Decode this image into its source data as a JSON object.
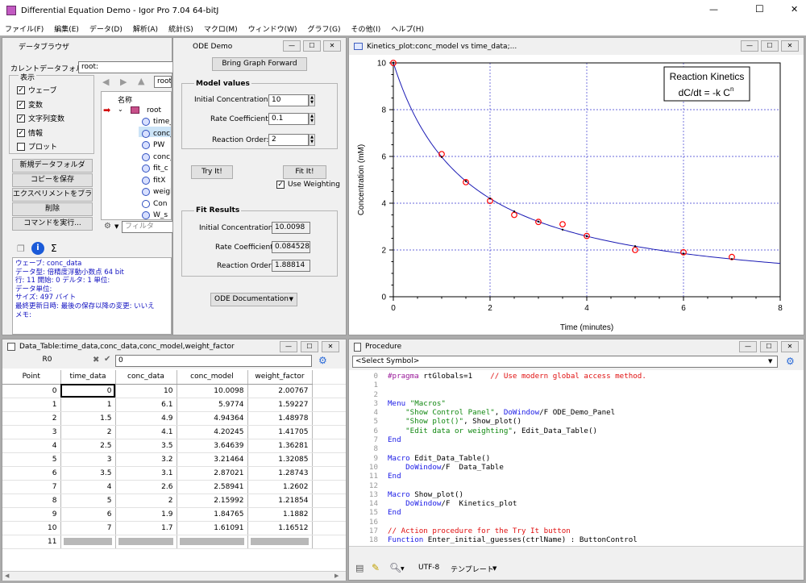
{
  "app": {
    "title": "Differential Equation Demo - Igor Pro 7.04 64-bitJ",
    "minimize": "—",
    "maximize": "☐",
    "close": "✕"
  },
  "menu": [
    "ファイル(F)",
    "編集(E)",
    "データ(D)",
    "解析(A)",
    "統計(S)",
    "マクロ(M)",
    "ウィンドウ(W)",
    "グラフ(G)",
    "その他(I)",
    "ヘルプ(H)"
  ],
  "browser": {
    "title": "データブラウザ",
    "cur_folder_label": "カレントデータフォルダ:",
    "cur_folder_value": "root:",
    "display_label": "表示",
    "checks": [
      {
        "label": "ウェーブ",
        "checked": "✓"
      },
      {
        "label": "変数",
        "checked": "✓"
      },
      {
        "label": "文字列変数",
        "checked": "✓"
      },
      {
        "label": "情報",
        "checked": "✓"
      },
      {
        "label": "プロット",
        "checked": ""
      }
    ],
    "buttons": [
      "新規データフォルダ",
      "コピーを保存",
      "エクスペリメントをブラウズ...",
      "削除",
      "コマンドを実行..."
    ],
    "path_value": "root",
    "tree_header": "名称",
    "tree_root": "root",
    "tree_items": [
      "time_data",
      "conc_data",
      "PW",
      "conc_model",
      "fit_c",
      "fitX",
      "weight_factor",
      "Con",
      "W_s"
    ],
    "filter_placeholder": "フィルタ",
    "info": {
      "l1": "ウェーブ: conc_data",
      "l2": "データ型: 倍精度浮動小数点 64 bit",
      "l3": "行: 11  開始: 0  デルタ: 1  単位:",
      "l4": "データ単位:",
      "l5": "サイズ: 497 バイト",
      "l6a": "最終更新日時:",
      "l6b": "最後の保存以降の変更: いいえ",
      "l7": "メモ:"
    }
  },
  "ode": {
    "title": "ODE Demo",
    "bring_btn": "Bring Graph Forward",
    "model_title": "Model values",
    "init_label": "Initial Concentration:",
    "init_value": "10",
    "rate_label": "Rate Coefficient:",
    "rate_value": "0.1",
    "order_label": "Reaction Order:",
    "order_value": "2",
    "tryit": "Try It!",
    "fitit": "Fit It!",
    "use_weighting": "Use Weighting",
    "use_weighting_checked": "✓",
    "fit_title": "Fit Results",
    "fit_init_label": "Initial Concentration:",
    "fit_init_value": "10.0098",
    "fit_rate_label": "Rate Coefficient:",
    "fit_rate_value": "0.0845284",
    "fit_order_label": "Reaction Order:",
    "fit_order_value": "1.88814",
    "doc_btn": "ODE Documentation"
  },
  "graph": {
    "title": "Kinetics_plot:conc_model vs time_data;...",
    "legend_title": "Reaction Kinetics",
    "legend_eq": "dC/dt = -k C",
    "legend_exp": "n"
  },
  "chart_data": {
    "type": "scatter",
    "xlabel": "Time (minutes)",
    "ylabel": "Concentration (mM)",
    "xlim": [
      0,
      8
    ],
    "ylim": [
      0,
      10
    ],
    "xticks": [
      "0",
      "2",
      "4",
      "6",
      "8"
    ],
    "yticks": [
      "0",
      "2",
      "4",
      "6",
      "8",
      "10"
    ],
    "grid": true,
    "x": [
      0,
      1,
      1.5,
      2,
      2.5,
      3,
      3.5,
      4,
      5,
      6,
      7
    ],
    "series": [
      {
        "values": [
          10,
          6.1,
          4.9,
          4.1,
          3.5,
          3.2,
          3.1,
          2.6,
          2,
          1.9,
          1.7
        ],
        "color": "#ff0000",
        "marker": "circle"
      },
      {
        "values": [
          10.0098,
          5.9774,
          4.94364,
          4.20245,
          3.64639,
          3.21464,
          2.87021,
          2.58941,
          2.15992,
          1.84765,
          1.61091
        ],
        "color": "#000000",
        "marker": "dot"
      }
    ],
    "curve": {
      "color": "#1a1ab4",
      "c0": 10.0098,
      "k": 0.0845284,
      "n": 1.88814,
      "xmax": 8
    }
  },
  "table": {
    "title": "Data_Table:time_data,conc_data,conc_model,weight_factor",
    "cell_ref": "R0",
    "entry_value": "0",
    "headers": [
      "Point",
      "time_data",
      "conc_data",
      "conc_model",
      "weight_factor"
    ],
    "rows": [
      [
        "0",
        "0",
        "10",
        "10.0098",
        "2.00767"
      ],
      [
        "1",
        "1",
        "6.1",
        "5.9774",
        "1.59227"
      ],
      [
        "2",
        "1.5",
        "4.9",
        "4.94364",
        "1.48978"
      ],
      [
        "3",
        "2",
        "4.1",
        "4.20245",
        "1.41705"
      ],
      [
        "4",
        "2.5",
        "3.5",
        "3.64639",
        "1.36281"
      ],
      [
        "5",
        "3",
        "3.2",
        "3.21464",
        "1.32085"
      ],
      [
        "6",
        "3.5",
        "3.1",
        "2.87021",
        "1.28743"
      ],
      [
        "7",
        "4",
        "2.6",
        "2.58941",
        "1.2602"
      ],
      [
        "8",
        "5",
        "2",
        "2.15992",
        "1.21854"
      ],
      [
        "9",
        "6",
        "1.9",
        "1.84765",
        "1.1882"
      ],
      [
        "10",
        "7",
        "1.7",
        "1.61091",
        "1.16512"
      ]
    ],
    "last_point": "11"
  },
  "procedure": {
    "title": "Procedure",
    "select_symbol": "<Select Symbol>",
    "encoding": "UTF-8",
    "template": "テンプレート",
    "lines": [
      {
        "n": "0",
        "parts": [
          {
            "c": "pr",
            "t": "#pragma"
          },
          {
            "c": "",
            "t": " rtGlobals=1    "
          },
          {
            "c": "cm",
            "t": "// Use modern global access method."
          }
        ]
      },
      {
        "n": "1",
        "parts": []
      },
      {
        "n": "2",
        "parts": []
      },
      {
        "n": "3",
        "parts": [
          {
            "c": "kw",
            "t": "Menu"
          },
          {
            "c": "",
            "t": " "
          },
          {
            "c": "st",
            "t": "\"Macros\""
          }
        ]
      },
      {
        "n": "4",
        "parts": [
          {
            "c": "",
            "t": "    "
          },
          {
            "c": "st",
            "t": "\"Show Control Panel\""
          },
          {
            "c": "",
            "t": ", "
          },
          {
            "c": "kw",
            "t": "DoWindow"
          },
          {
            "c": "",
            "t": "/F ODE_Demo_Panel"
          }
        ]
      },
      {
        "n": "5",
        "parts": [
          {
            "c": "",
            "t": "    "
          },
          {
            "c": "st",
            "t": "\"Show plot()\""
          },
          {
            "c": "",
            "t": ", Show_plot()"
          }
        ]
      },
      {
        "n": "6",
        "parts": [
          {
            "c": "",
            "t": "    "
          },
          {
            "c": "st",
            "t": "\"Edit data or weighting\""
          },
          {
            "c": "",
            "t": ", Edit_Data_Table()"
          }
        ]
      },
      {
        "n": "7",
        "parts": [
          {
            "c": "kw",
            "t": "End"
          }
        ]
      },
      {
        "n": "8",
        "parts": []
      },
      {
        "n": "9",
        "parts": [
          {
            "c": "kw",
            "t": "Macro"
          },
          {
            "c": "",
            "t": " Edit_Data_Table()"
          }
        ]
      },
      {
        "n": "10",
        "parts": [
          {
            "c": "",
            "t": "    "
          },
          {
            "c": "kw",
            "t": "DoWindow"
          },
          {
            "c": "",
            "t": "/F  Data_Table"
          }
        ]
      },
      {
        "n": "11",
        "parts": [
          {
            "c": "kw",
            "t": "End"
          }
        ]
      },
      {
        "n": "12",
        "parts": []
      },
      {
        "n": "13",
        "parts": [
          {
            "c": "kw",
            "t": "Macro"
          },
          {
            "c": "",
            "t": " Show_plot()"
          }
        ]
      },
      {
        "n": "14",
        "parts": [
          {
            "c": "",
            "t": "    "
          },
          {
            "c": "kw",
            "t": "DoWindow"
          },
          {
            "c": "",
            "t": "/F  Kinetics_plot"
          }
        ]
      },
      {
        "n": "15",
        "parts": [
          {
            "c": "kw",
            "t": "End"
          }
        ]
      },
      {
        "n": "16",
        "parts": []
      },
      {
        "n": "17",
        "parts": [
          {
            "c": "cm",
            "t": "// Action procedure for the Try It button"
          }
        ]
      },
      {
        "n": "18",
        "parts": [
          {
            "c": "kw",
            "t": "Function"
          },
          {
            "c": "",
            "t": " Enter_initial_guesses(ctrlName) : ButtonControl"
          }
        ]
      }
    ]
  }
}
